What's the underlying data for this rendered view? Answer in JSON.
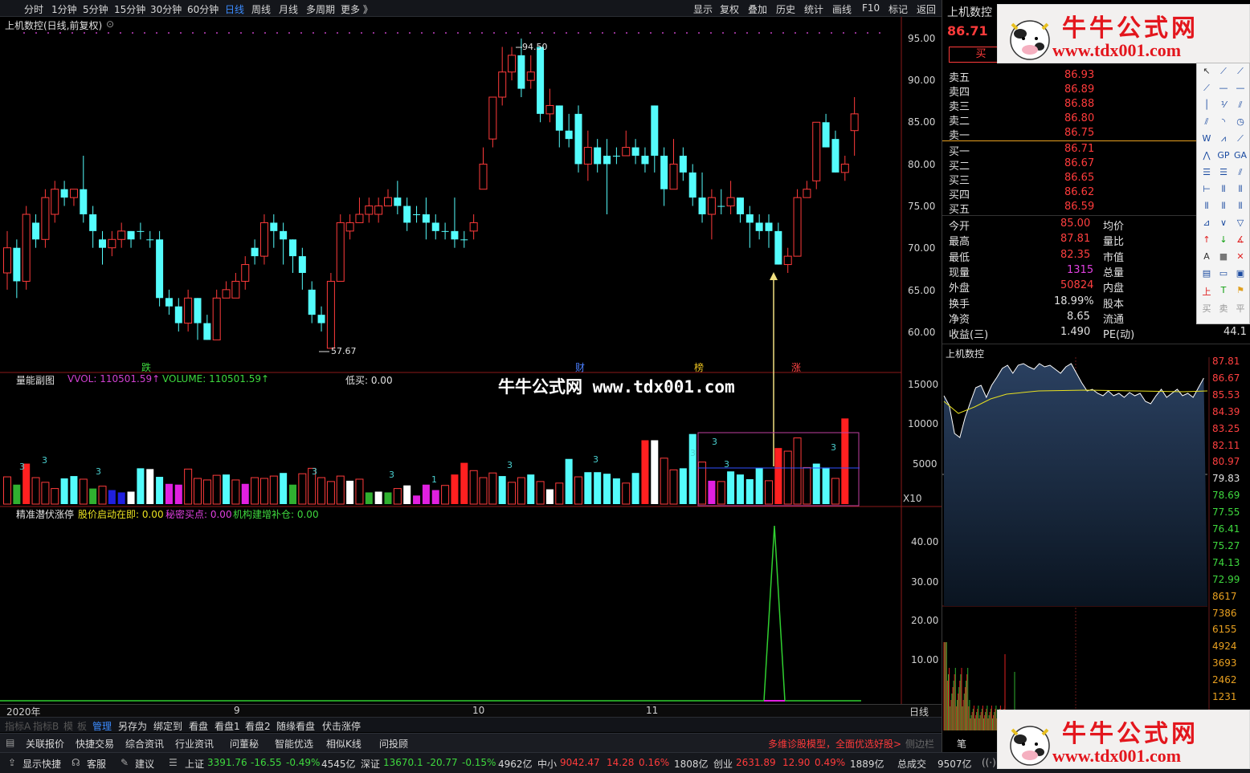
{
  "topbar": {
    "periods": [
      "分时",
      "1分钟",
      "5分钟",
      "15分钟",
      "30分钟",
      "60分钟",
      "日线",
      "周线",
      "月线",
      "多周期",
      "更多 》"
    ],
    "active_period": "日线",
    "right_menu": [
      "显示",
      "复权",
      "叠加",
      "历史",
      "统计",
      "画线",
      "F10",
      "标记",
      "返回"
    ]
  },
  "chart": {
    "title": "上机数控(日线,前复权)",
    "high_label": "94.50",
    "low_label": "57.67",
    "price_axis": [
      "95.00",
      "90.00",
      "85.00",
      "80.00",
      "75.00",
      "70.00",
      "65.00",
      "60.00"
    ],
    "markers": [
      {
        "text": "跌",
        "color": "#3ed83e"
      },
      {
        "text": "财",
        "color": "#4a7fff"
      },
      {
        "text": "榜",
        "color": "#e8c020"
      },
      {
        "text": "涨",
        "color": "#ff4444"
      }
    ],
    "volume_title": "量能副图",
    "vvol_label": "VVOL: 110501.59↑",
    "volume_label": "VOLUME: 110501.59↑",
    "low_buy_label": "低买: 0.00",
    "volume_axis": [
      "15000",
      "10000",
      "5000"
    ],
    "volume_unit": "X10",
    "indicator_title": "精准潜伏涨停",
    "ind_a": "股价启动在即: 0.00",
    "ind_b": "秘密买点: 0.00",
    "ind_c": "机构建增补仓: 0.00",
    "indicator_axis": [
      "40.00",
      "30.00",
      "20.00",
      "10.00"
    ],
    "date_labels": [
      "2020年",
      "9",
      "10",
      "11"
    ],
    "date_right": "日线",
    "watermark": "牛牛公式网 www.tdx001.com"
  },
  "chart_data": {
    "type": "candlestick",
    "ylim": [
      57,
      97
    ],
    "highest": 94.5,
    "lowest": 57.67,
    "candles": [
      [
        67,
        70,
        65,
        72,
        "r"
      ],
      [
        70,
        66,
        64,
        71,
        "c"
      ],
      [
        66,
        74,
        65,
        75,
        "r"
      ],
      [
        73,
        71,
        70,
        74,
        "c"
      ],
      [
        71,
        76,
        70,
        77,
        "r"
      ],
      [
        74,
        77,
        73,
        78,
        "r"
      ],
      [
        77,
        76,
        75,
        78,
        "c"
      ],
      [
        76,
        77,
        75,
        77,
        "r"
      ],
      [
        77,
        74,
        73,
        81,
        "c"
      ],
      [
        74,
        72,
        70,
        75,
        "c"
      ],
      [
        71,
        70,
        68,
        72,
        "c"
      ],
      [
        70,
        71,
        69,
        72,
        "r"
      ],
      [
        71,
        72,
        70,
        73,
        "r"
      ],
      [
        72,
        71,
        70,
        72,
        "c"
      ],
      [
        72,
        72,
        71,
        73,
        "c"
      ],
      [
        71,
        71,
        70,
        72,
        "c"
      ],
      [
        71,
        64,
        63,
        72,
        "c"
      ],
      [
        64,
        63,
        62,
        65,
        "c"
      ],
      [
        63,
        61,
        60,
        64,
        "c"
      ],
      [
        61,
        64,
        60,
        65,
        "r"
      ],
      [
        64,
        61,
        59,
        64,
        "c"
      ],
      [
        61,
        59,
        59,
        62,
        "c"
      ],
      [
        59,
        64,
        59,
        65,
        "r"
      ],
      [
        64,
        65,
        64,
        66,
        "r"
      ],
      [
        64,
        66,
        64,
        67,
        "r"
      ],
      [
        66,
        68,
        65,
        69,
        "r"
      ],
      [
        69,
        70,
        68,
        71,
        "c"
      ],
      [
        69,
        73,
        68,
        74,
        "r"
      ],
      [
        73,
        72,
        70,
        74,
        "c"
      ],
      [
        72,
        71,
        68,
        73,
        "c"
      ],
      [
        71,
        69,
        67,
        71,
        "c"
      ],
      [
        69,
        67,
        65,
        70,
        "c"
      ],
      [
        65,
        62,
        61,
        66,
        "c"
      ],
      [
        62,
        61,
        60,
        63,
        "c"
      ],
      [
        58,
        66,
        58,
        67,
        "r"
      ],
      [
        66,
        73,
        66,
        74,
        "r"
      ],
      [
        72,
        73,
        71,
        74,
        "r"
      ],
      [
        73,
        74,
        73,
        76,
        "r"
      ],
      [
        74,
        75,
        73,
        76,
        "r"
      ],
      [
        74,
        75,
        73,
        76,
        "r"
      ],
      [
        75,
        76,
        75,
        77,
        "r"
      ],
      [
        76,
        75,
        74,
        78,
        "c"
      ],
      [
        75,
        73,
        72,
        76,
        "c"
      ],
      [
        74,
        74,
        73,
        75,
        "c"
      ],
      [
        74,
        73,
        71,
        76,
        "c"
      ],
      [
        73,
        72,
        71,
        74,
        "c"
      ],
      [
        72,
        72,
        71,
        73,
        "c"
      ],
      [
        72,
        71,
        70,
        76,
        "c"
      ],
      [
        71,
        71,
        70,
        72,
        "c"
      ],
      [
        72,
        73,
        71,
        74,
        "r"
      ],
      [
        77,
        80,
        77,
        82,
        "r"
      ],
      [
        83,
        88,
        82,
        88,
        "r"
      ],
      [
        88,
        91,
        87,
        94,
        "r"
      ],
      [
        91,
        93,
        90,
        94,
        "r"
      ],
      [
        93,
        89,
        88,
        95,
        "c"
      ],
      [
        90,
        91,
        89,
        93,
        "r"
      ],
      [
        94,
        86,
        85,
        94,
        "c"
      ],
      [
        86,
        87,
        85,
        89,
        "r"
      ],
      [
        87,
        84,
        82,
        87,
        "c"
      ],
      [
        84,
        83,
        82,
        86,
        "c"
      ],
      [
        86,
        80,
        79,
        87,
        "c"
      ],
      [
        80,
        82,
        78,
        84,
        "r"
      ],
      [
        82,
        80,
        79,
        83,
        "c"
      ],
      [
        80,
        81,
        74,
        83,
        "c"
      ],
      [
        81,
        81,
        80,
        82,
        "c"
      ],
      [
        81,
        82,
        81,
        84,
        "r"
      ],
      [
        82,
        81,
        80,
        83,
        "c"
      ],
      [
        81,
        80,
        79,
        82,
        "c"
      ],
      [
        87,
        81,
        79,
        87,
        "c"
      ],
      [
        81,
        77,
        75,
        82,
        "c"
      ],
      [
        77,
        80,
        77,
        83,
        "r"
      ],
      [
        81,
        79,
        78,
        82,
        "c"
      ],
      [
        79,
        76,
        75,
        80,
        "c"
      ],
      [
        76,
        74,
        73,
        79,
        "c"
      ],
      [
        74,
        76,
        71,
        77,
        "r"
      ],
      [
        75,
        75,
        74,
        77,
        "c"
      ],
      [
        75,
        76,
        74,
        78,
        "r"
      ],
      [
        76,
        74,
        73,
        76,
        "c"
      ],
      [
        74,
        73,
        70,
        75,
        "c"
      ],
      [
        73,
        72,
        71,
        74,
        "c"
      ],
      [
        73,
        72,
        70,
        74,
        "c"
      ],
      [
        72,
        68,
        68,
        73,
        "c"
      ],
      [
        68,
        69,
        67,
        70,
        "r"
      ],
      [
        69,
        76,
        69,
        77,
        "r"
      ],
      [
        76,
        77,
        76,
        78,
        "r"
      ],
      [
        78,
        85,
        77,
        85,
        "r"
      ],
      [
        85,
        82,
        82,
        86,
        "c"
      ],
      [
        83,
        79,
        79,
        84,
        "c"
      ],
      [
        79,
        80,
        78,
        81,
        "r"
      ],
      [
        84,
        86,
        81,
        88,
        "r"
      ]
    ],
    "volumes": [],
    "indicator_peak": 45
  },
  "right": {
    "stock_name": "上机数控",
    "price": "86.71",
    "buy_button": "买",
    "asks": [
      {
        "label": "卖五",
        "price": "86.93"
      },
      {
        "label": "卖四",
        "price": "86.89"
      },
      {
        "label": "卖三",
        "price": "86.88"
      },
      {
        "label": "卖二",
        "price": "86.80"
      },
      {
        "label": "卖一",
        "price": "86.75"
      }
    ],
    "bids": [
      {
        "label": "买一",
        "price": "86.71"
      },
      {
        "label": "买二",
        "price": "86.67"
      },
      {
        "label": "买三",
        "price": "86.65"
      },
      {
        "label": "买四",
        "price": "86.62"
      },
      {
        "label": "买五",
        "price": "86.59"
      }
    ],
    "stats": [
      {
        "label": "今开",
        "value": "85.00",
        "color": "#ff4040",
        "right": "均价"
      },
      {
        "label": "最高",
        "value": "87.81",
        "color": "#ff4040",
        "right": "量比"
      },
      {
        "label": "最低",
        "value": "82.35",
        "color": "#ff4040",
        "right": "市值"
      },
      {
        "label": "现量",
        "value": "1315",
        "color": "#e040e0",
        "right": "总量"
      },
      {
        "label": "外盘",
        "value": "50824",
        "color": "#ff4040",
        "right": "内盘"
      },
      {
        "label": "换手",
        "value": "18.99%",
        "color": "#e0e0e0",
        "right": "股本"
      },
      {
        "label": "净资",
        "value": "8.65",
        "color": "#e0e0e0",
        "right": "流通"
      },
      {
        "label": "收益(三)",
        "value": "1.490",
        "color": "#e0e0e0",
        "right": "PE(动)"
      }
    ],
    "pe_value": "44.1",
    "intraday_title": "上机数控",
    "intraday_axis": [
      {
        "v": "87.81",
        "c": "#ff4040"
      },
      {
        "v": "86.67",
        "c": "#ff4040"
      },
      {
        "v": "85.53",
        "c": "#ff4040"
      },
      {
        "v": "84.39",
        "c": "#ff4040"
      },
      {
        "v": "83.25",
        "c": "#ff4040"
      },
      {
        "v": "82.11",
        "c": "#ff4040"
      },
      {
        "v": "80.97",
        "c": "#ff4040"
      },
      {
        "v": "79.83",
        "c": "#e0e0e0"
      },
      {
        "v": "78.69",
        "c": "#3ed83e"
      },
      {
        "v": "77.55",
        "c": "#3ed83e"
      },
      {
        "v": "76.41",
        "c": "#3ed83e"
      },
      {
        "v": "75.27",
        "c": "#3ed83e"
      },
      {
        "v": "74.13",
        "c": "#3ed83e"
      },
      {
        "v": "72.99",
        "c": "#3ed83e"
      },
      {
        "v": "8617",
        "c": "#e8a020"
      },
      {
        "v": "7386",
        "c": "#e8a020"
      },
      {
        "v": "6155",
        "c": "#e8a020"
      },
      {
        "v": "4924",
        "c": "#e8a020"
      },
      {
        "v": "3693",
        "c": "#e8a020"
      },
      {
        "v": "2462",
        "c": "#e8a020"
      },
      {
        "v": "1231",
        "c": "#e8a020"
      }
    ],
    "bottom_tab": "笔"
  },
  "logo": {
    "line1": "牛牛公式网",
    "line2": "www.tdx001.com"
  },
  "idxbar": {
    "dim": [
      "指标A",
      "指标B",
      "模",
      "板"
    ],
    "items": [
      "管理",
      "另存为",
      "绑定到",
      "看盘",
      "看盘1",
      "看盘2",
      "随缘看盘",
      "伏击涨停"
    ]
  },
  "funcbar": {
    "items": [
      "关联报价",
      "快捷交易",
      "综合资讯",
      "行业资讯",
      "问董秘",
      "智能优选",
      "相似K线",
      "问投顾"
    ],
    "promo": "多维诊股模型，全面优选好股>",
    "side": "侧边栏"
  },
  "statusbar": {
    "left": [
      "显示快捷",
      "客服",
      "建议"
    ],
    "sh": {
      "name": "上证",
      "v": "3391.76",
      "chg": "-16.55",
      "pct": "-0.49%",
      "amt": "4545亿"
    },
    "sz": {
      "name": "深证",
      "v": "13670.1",
      "chg": "-20.77",
      "pct": "-0.15%",
      "amt": "4962亿"
    },
    "zx": {
      "name": "中小",
      "v": "9042.47",
      "chg": "14.28",
      "pct": "0.16%",
      "amt": "1808亿"
    },
    "cy": {
      "name": "创业",
      "v": "2631.89",
      "chg": "12.90",
      "pct": "0.49%",
      "amt": "1889亿"
    },
    "total_label": "总成交",
    "total": "9507亿"
  },
  "colors": {
    "up": "#ff3b3b",
    "down": "#54fcfc",
    "bg": "#000000",
    "accent": "#3c8cff",
    "gold": "#f0e080"
  }
}
